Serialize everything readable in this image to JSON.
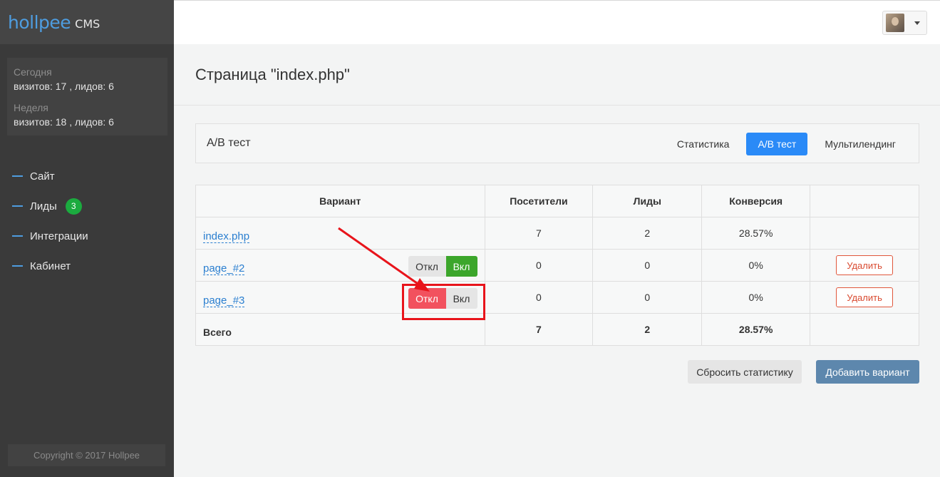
{
  "logo": {
    "main": "hollpee",
    "suffix": "CMS"
  },
  "stats": {
    "today_label": "Сегодня",
    "today_value": "визитов: 17 , лидов: 6",
    "week_label": "Неделя",
    "week_value": "визитов: 18 , лидов: 6"
  },
  "nav": [
    {
      "label": "Сайт"
    },
    {
      "label": "Лиды",
      "badge": "3"
    },
    {
      "label": "Интеграции"
    },
    {
      "label": "Кабинет"
    }
  ],
  "copyright": "Copyright © 2017 Hollpee",
  "page_title": "Страница \"index.php\"",
  "panel": {
    "title": "А/B тест",
    "tabs": [
      "Статистика",
      "А/B тест",
      "Мультилендинг"
    ],
    "active_tab": "А/B тест"
  },
  "table": {
    "headers": [
      "Вариант",
      "Посетители",
      "Лиды",
      "Конверсия",
      ""
    ],
    "rows": [
      {
        "variant": "index.php",
        "visitors": "7",
        "leads": "2",
        "conversion": "28.57%"
      },
      {
        "variant": "page_#2",
        "toggle_off": "Откл",
        "toggle_on": "Вкл",
        "toggle_state": "on",
        "visitors": "0",
        "leads": "0",
        "conversion": "0%",
        "action": "Удалить"
      },
      {
        "variant": "page_#3",
        "toggle_off": "Откл",
        "toggle_on": "Вкл",
        "toggle_state": "off",
        "visitors": "0",
        "leads": "0",
        "conversion": "0%",
        "action": "Удалить"
      }
    ],
    "total": {
      "label": "Всего",
      "visitors": "7",
      "leads": "2",
      "conversion": "28.57%"
    }
  },
  "buttons": {
    "reset": "Сбросить статистику",
    "add": "Добавить вариант"
  },
  "colors": {
    "sidebar_bg": "#3a3a3a",
    "accent_blue": "#2a8af7",
    "toggle_on_green": "#3ca62b",
    "toggle_off_red": "#f2515e",
    "delete_red": "#e0573c",
    "add_button": "#5d87ad",
    "annotation_red": "#e8141b"
  }
}
